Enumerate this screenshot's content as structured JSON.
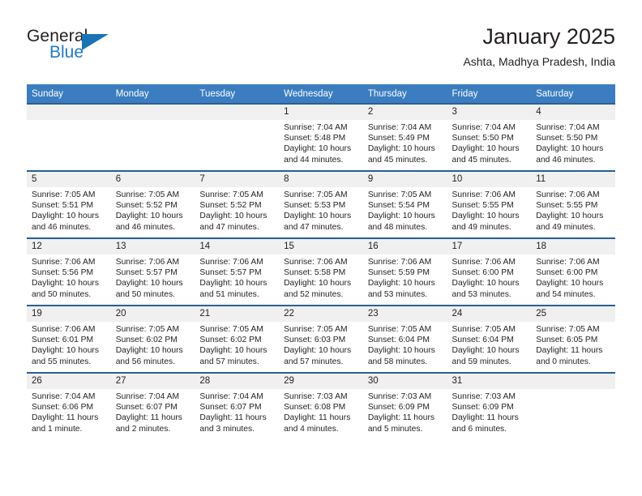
{
  "brand": {
    "name_part1": "General",
    "name_part2": "Blue",
    "logo_icon": "triangle-flag-icon"
  },
  "header": {
    "title": "January 2025",
    "location": "Ashta, Madhya Pradesh, India"
  },
  "colors": {
    "header_blue": "#3b7dc0",
    "row_divider": "#2c5f94",
    "daynum_band": "#f0f0f0",
    "brand_blue": "#1f7ac4",
    "text": "#231f20"
  },
  "weekdays": [
    "Sunday",
    "Monday",
    "Tuesday",
    "Wednesday",
    "Thursday",
    "Friday",
    "Saturday"
  ],
  "weeks": [
    [
      {
        "day": "",
        "empty": true,
        "sunrise": "",
        "sunset": "",
        "daylight1": "",
        "daylight2": ""
      },
      {
        "day": "",
        "empty": true,
        "sunrise": "",
        "sunset": "",
        "daylight1": "",
        "daylight2": ""
      },
      {
        "day": "",
        "empty": true,
        "sunrise": "",
        "sunset": "",
        "daylight1": "",
        "daylight2": ""
      },
      {
        "day": "1",
        "empty": false,
        "sunrise": "Sunrise: 7:04 AM",
        "sunset": "Sunset: 5:48 PM",
        "daylight1": "Daylight: 10 hours",
        "daylight2": "and 44 minutes."
      },
      {
        "day": "2",
        "empty": false,
        "sunrise": "Sunrise: 7:04 AM",
        "sunset": "Sunset: 5:49 PM",
        "daylight1": "Daylight: 10 hours",
        "daylight2": "and 45 minutes."
      },
      {
        "day": "3",
        "empty": false,
        "sunrise": "Sunrise: 7:04 AM",
        "sunset": "Sunset: 5:50 PM",
        "daylight1": "Daylight: 10 hours",
        "daylight2": "and 45 minutes."
      },
      {
        "day": "4",
        "empty": false,
        "sunrise": "Sunrise: 7:04 AM",
        "sunset": "Sunset: 5:50 PM",
        "daylight1": "Daylight: 10 hours",
        "daylight2": "and 46 minutes."
      }
    ],
    [
      {
        "day": "5",
        "empty": false,
        "sunrise": "Sunrise: 7:05 AM",
        "sunset": "Sunset: 5:51 PM",
        "daylight1": "Daylight: 10 hours",
        "daylight2": "and 46 minutes."
      },
      {
        "day": "6",
        "empty": false,
        "sunrise": "Sunrise: 7:05 AM",
        "sunset": "Sunset: 5:52 PM",
        "daylight1": "Daylight: 10 hours",
        "daylight2": "and 46 minutes."
      },
      {
        "day": "7",
        "empty": false,
        "sunrise": "Sunrise: 7:05 AM",
        "sunset": "Sunset: 5:52 PM",
        "daylight1": "Daylight: 10 hours",
        "daylight2": "and 47 minutes."
      },
      {
        "day": "8",
        "empty": false,
        "sunrise": "Sunrise: 7:05 AM",
        "sunset": "Sunset: 5:53 PM",
        "daylight1": "Daylight: 10 hours",
        "daylight2": "and 47 minutes."
      },
      {
        "day": "9",
        "empty": false,
        "sunrise": "Sunrise: 7:05 AM",
        "sunset": "Sunset: 5:54 PM",
        "daylight1": "Daylight: 10 hours",
        "daylight2": "and 48 minutes."
      },
      {
        "day": "10",
        "empty": false,
        "sunrise": "Sunrise: 7:06 AM",
        "sunset": "Sunset: 5:55 PM",
        "daylight1": "Daylight: 10 hours",
        "daylight2": "and 49 minutes."
      },
      {
        "day": "11",
        "empty": false,
        "sunrise": "Sunrise: 7:06 AM",
        "sunset": "Sunset: 5:55 PM",
        "daylight1": "Daylight: 10 hours",
        "daylight2": "and 49 minutes."
      }
    ],
    [
      {
        "day": "12",
        "empty": false,
        "sunrise": "Sunrise: 7:06 AM",
        "sunset": "Sunset: 5:56 PM",
        "daylight1": "Daylight: 10 hours",
        "daylight2": "and 50 minutes."
      },
      {
        "day": "13",
        "empty": false,
        "sunrise": "Sunrise: 7:06 AM",
        "sunset": "Sunset: 5:57 PM",
        "daylight1": "Daylight: 10 hours",
        "daylight2": "and 50 minutes."
      },
      {
        "day": "14",
        "empty": false,
        "sunrise": "Sunrise: 7:06 AM",
        "sunset": "Sunset: 5:57 PM",
        "daylight1": "Daylight: 10 hours",
        "daylight2": "and 51 minutes."
      },
      {
        "day": "15",
        "empty": false,
        "sunrise": "Sunrise: 7:06 AM",
        "sunset": "Sunset: 5:58 PM",
        "daylight1": "Daylight: 10 hours",
        "daylight2": "and 52 minutes."
      },
      {
        "day": "16",
        "empty": false,
        "sunrise": "Sunrise: 7:06 AM",
        "sunset": "Sunset: 5:59 PM",
        "daylight1": "Daylight: 10 hours",
        "daylight2": "and 53 minutes."
      },
      {
        "day": "17",
        "empty": false,
        "sunrise": "Sunrise: 7:06 AM",
        "sunset": "Sunset: 6:00 PM",
        "daylight1": "Daylight: 10 hours",
        "daylight2": "and 53 minutes."
      },
      {
        "day": "18",
        "empty": false,
        "sunrise": "Sunrise: 7:06 AM",
        "sunset": "Sunset: 6:00 PM",
        "daylight1": "Daylight: 10 hours",
        "daylight2": "and 54 minutes."
      }
    ],
    [
      {
        "day": "19",
        "empty": false,
        "sunrise": "Sunrise: 7:06 AM",
        "sunset": "Sunset: 6:01 PM",
        "daylight1": "Daylight: 10 hours",
        "daylight2": "and 55 minutes."
      },
      {
        "day": "20",
        "empty": false,
        "sunrise": "Sunrise: 7:05 AM",
        "sunset": "Sunset: 6:02 PM",
        "daylight1": "Daylight: 10 hours",
        "daylight2": "and 56 minutes."
      },
      {
        "day": "21",
        "empty": false,
        "sunrise": "Sunrise: 7:05 AM",
        "sunset": "Sunset: 6:02 PM",
        "daylight1": "Daylight: 10 hours",
        "daylight2": "and 57 minutes."
      },
      {
        "day": "22",
        "empty": false,
        "sunrise": "Sunrise: 7:05 AM",
        "sunset": "Sunset: 6:03 PM",
        "daylight1": "Daylight: 10 hours",
        "daylight2": "and 57 minutes."
      },
      {
        "day": "23",
        "empty": false,
        "sunrise": "Sunrise: 7:05 AM",
        "sunset": "Sunset: 6:04 PM",
        "daylight1": "Daylight: 10 hours",
        "daylight2": "and 58 minutes."
      },
      {
        "day": "24",
        "empty": false,
        "sunrise": "Sunrise: 7:05 AM",
        "sunset": "Sunset: 6:04 PM",
        "daylight1": "Daylight: 10 hours",
        "daylight2": "and 59 minutes."
      },
      {
        "day": "25",
        "empty": false,
        "sunrise": "Sunrise: 7:05 AM",
        "sunset": "Sunset: 6:05 PM",
        "daylight1": "Daylight: 11 hours",
        "daylight2": "and 0 minutes."
      }
    ],
    [
      {
        "day": "26",
        "empty": false,
        "sunrise": "Sunrise: 7:04 AM",
        "sunset": "Sunset: 6:06 PM",
        "daylight1": "Daylight: 11 hours",
        "daylight2": "and 1 minute."
      },
      {
        "day": "27",
        "empty": false,
        "sunrise": "Sunrise: 7:04 AM",
        "sunset": "Sunset: 6:07 PM",
        "daylight1": "Daylight: 11 hours",
        "daylight2": "and 2 minutes."
      },
      {
        "day": "28",
        "empty": false,
        "sunrise": "Sunrise: 7:04 AM",
        "sunset": "Sunset: 6:07 PM",
        "daylight1": "Daylight: 11 hours",
        "daylight2": "and 3 minutes."
      },
      {
        "day": "29",
        "empty": false,
        "sunrise": "Sunrise: 7:03 AM",
        "sunset": "Sunset: 6:08 PM",
        "daylight1": "Daylight: 11 hours",
        "daylight2": "and 4 minutes."
      },
      {
        "day": "30",
        "empty": false,
        "sunrise": "Sunrise: 7:03 AM",
        "sunset": "Sunset: 6:09 PM",
        "daylight1": "Daylight: 11 hours",
        "daylight2": "and 5 minutes."
      },
      {
        "day": "31",
        "empty": false,
        "sunrise": "Sunrise: 7:03 AM",
        "sunset": "Sunset: 6:09 PM",
        "daylight1": "Daylight: 11 hours",
        "daylight2": "and 6 minutes."
      },
      {
        "day": "",
        "empty": true,
        "sunrise": "",
        "sunset": "",
        "daylight1": "",
        "daylight2": ""
      }
    ]
  ]
}
